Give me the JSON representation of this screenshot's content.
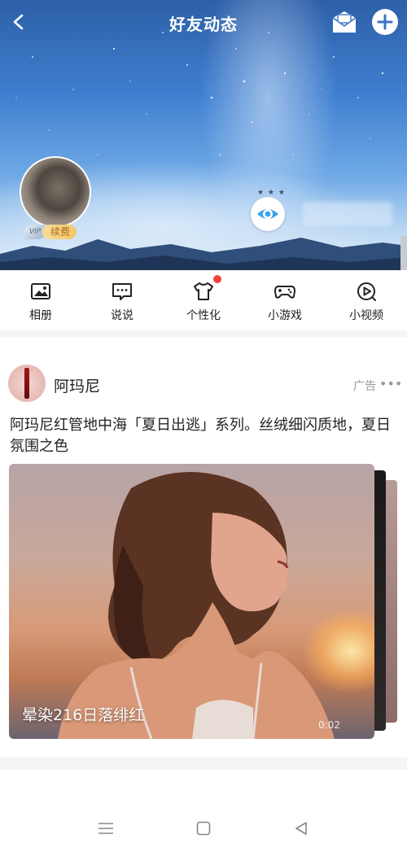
{
  "header": {
    "title": "好友动态",
    "vip_tag": "续费",
    "vip_wing": "VIP",
    "visitor_dots": "★ ★ ★"
  },
  "quick_menu": [
    {
      "label": "相册",
      "icon": "album-icon"
    },
    {
      "label": "说说",
      "icon": "shuoshuo-icon"
    },
    {
      "label": "个性化",
      "icon": "tshirt-icon",
      "has_badge": true
    },
    {
      "label": "小游戏",
      "icon": "gamepad-icon"
    },
    {
      "label": "小视频",
      "icon": "video-icon"
    }
  ],
  "post": {
    "author": "阿玛尼",
    "ad_label": "广告",
    "more": "•••",
    "text": "阿玛尼红管地中海「夏日出逃」系列。丝绒细闪质地，夏日氛围之色",
    "media_caption": "晕染216日落绯红",
    "media_time": "0:02"
  },
  "colors": {
    "accent": "#f04438",
    "vip_gold": "#f2c969"
  }
}
